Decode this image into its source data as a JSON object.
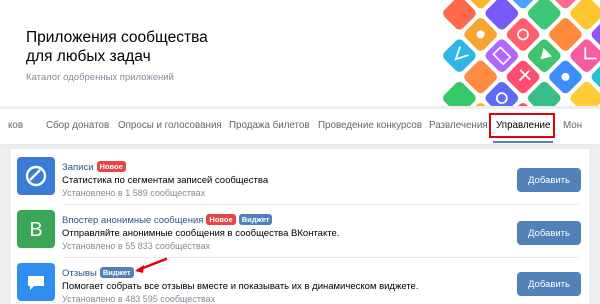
{
  "hero": {
    "title_line1": "Приложения сообщества",
    "title_line2": "для любых задач",
    "subtitle": "Каталог одобренных приложений"
  },
  "tabs": [
    {
      "label": "ков"
    },
    {
      "label": "Сбор донатов"
    },
    {
      "label": "Опросы и голосования"
    },
    {
      "label": "Продажа билетов"
    },
    {
      "label": "Проведение конкурсов"
    },
    {
      "label": "Развлечения"
    },
    {
      "label": "Управление",
      "active": true
    },
    {
      "label": "Мон"
    }
  ],
  "apps": [
    {
      "name": "Записи",
      "badges": [
        "Новое"
      ],
      "description": "Статистика по сегментам записей сообщества",
      "installs": "Установлено в 1 589 сообществах",
      "button": "Добавить",
      "icon": "records-icon",
      "icon_color": "#3a7bd5"
    },
    {
      "name": "Впостер анонимные сообщения",
      "badges": [
        "Новое",
        "Виджет"
      ],
      "description": "Отправляйте анонимные сообщения в сообщества ВКонтакте.",
      "installs": "Установлено в 55 833 сообществах",
      "button": "Добавить",
      "icon": "letter-b-icon",
      "icon_color": "#3aa757"
    },
    {
      "name": "Отзывы",
      "badges": [
        "Виджет"
      ],
      "description": "Помогает собрать все отзывы вместе и показывать их в динамическом виджете.",
      "installs": "Установлено в 483 595 сообществах",
      "button": "Добавить",
      "icon": "chat-bubble-icon",
      "icon_color": "#2f8ff0"
    }
  ],
  "colors": {
    "accent": "#5181b8",
    "badge_new": "#e64646",
    "highlight": "#e3000b"
  }
}
